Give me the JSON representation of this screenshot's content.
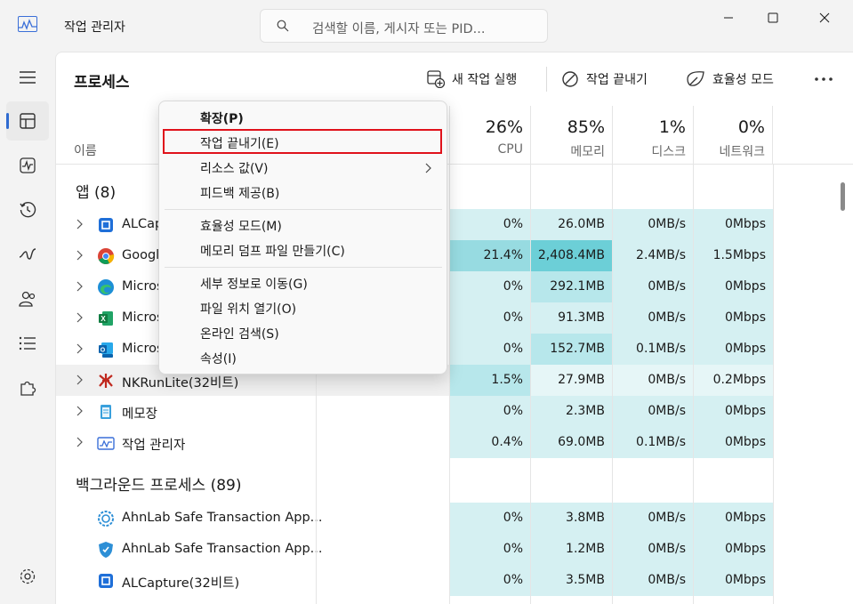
{
  "window": {
    "title": "작업 관리자",
    "search_placeholder": "검색할 이름, 게시자 또는 PID..."
  },
  "nav": {
    "items": [
      "hamburger-menu",
      "processes",
      "performance",
      "app-history",
      "startup-apps",
      "users",
      "details",
      "services",
      "settings"
    ],
    "active": "processes"
  },
  "toolbar": {
    "title": "프로세스",
    "run_new_task": "새 작업 실행",
    "end_task": "작업 끝내기",
    "efficiency_mode": "효율성 모드",
    "more": "..."
  },
  "columns": {
    "name": "이름",
    "cpu": {
      "pct": "26%",
      "label": "CPU"
    },
    "memory": {
      "pct": "85%",
      "label": "메모리"
    },
    "disk": {
      "pct": "1%",
      "label": "디스크"
    },
    "network": {
      "pct": "0%",
      "label": "네트워크"
    }
  },
  "sections": {
    "apps": "앱 (8)",
    "background": "백그라운드 프로세스 (89)"
  },
  "apps": [
    {
      "name": "ALCap",
      "cpu": "0%",
      "mem": "26.0MB",
      "disk": "0MB/s",
      "net": "0Mbps"
    },
    {
      "name": "Googl",
      "cpu": "21.4%",
      "mem": "2,408.4MB",
      "disk": "2.4MB/s",
      "net": "1.5Mbps"
    },
    {
      "name": "Micros",
      "cpu": "0%",
      "mem": "292.1MB",
      "disk": "0MB/s",
      "net": "0Mbps"
    },
    {
      "name": "Micros",
      "cpu": "0%",
      "mem": "91.3MB",
      "disk": "0MB/s",
      "net": "0Mbps"
    },
    {
      "name": "Micros",
      "cpu": "0%",
      "mem": "152.7MB",
      "disk": "0.1MB/s",
      "net": "0Mbps"
    },
    {
      "name": "NKRunLite(32비트)",
      "cpu": "1.5%",
      "mem": "27.9MB",
      "disk": "0MB/s",
      "net": "0.2Mbps"
    },
    {
      "name": "메모장",
      "cpu": "0%",
      "mem": "2.3MB",
      "disk": "0MB/s",
      "net": "0Mbps"
    },
    {
      "name": "작업 관리자",
      "cpu": "0.4%",
      "mem": "69.0MB",
      "disk": "0.1MB/s",
      "net": "0Mbps"
    }
  ],
  "background": [
    {
      "name": "AhnLab Safe Transaction App...",
      "cpu": "0%",
      "mem": "3.8MB",
      "disk": "0MB/s",
      "net": "0Mbps"
    },
    {
      "name": "AhnLab Safe Transaction App...",
      "cpu": "0%",
      "mem": "1.2MB",
      "disk": "0MB/s",
      "net": "0Mbps"
    },
    {
      "name": "ALCapture(32비트)",
      "cpu": "0%",
      "mem": "3.5MB",
      "disk": "0MB/s",
      "net": "0Mbps"
    }
  ],
  "context_menu": {
    "expand": "확장(P)",
    "end_task": "작업 끝내기(E)",
    "resource_values": "리소스 값(V)",
    "feedback": "피드백 제공(B)",
    "efficiency_mode": "효율성 모드(M)",
    "memory_dump": "메모리 덤프 파일 만들기(C)",
    "go_to_details": "세부 정보로 이동(G)",
    "open_file_location": "파일 위치 열기(O)",
    "search_online": "온라인 검색(S)",
    "properties": "속성(I)"
  },
  "colors": {
    "accent": "#2f6bd0",
    "highlight_box": "#e0121b",
    "heat_low": "#d5f0f2",
    "heat_high": "#6ccfd7"
  }
}
